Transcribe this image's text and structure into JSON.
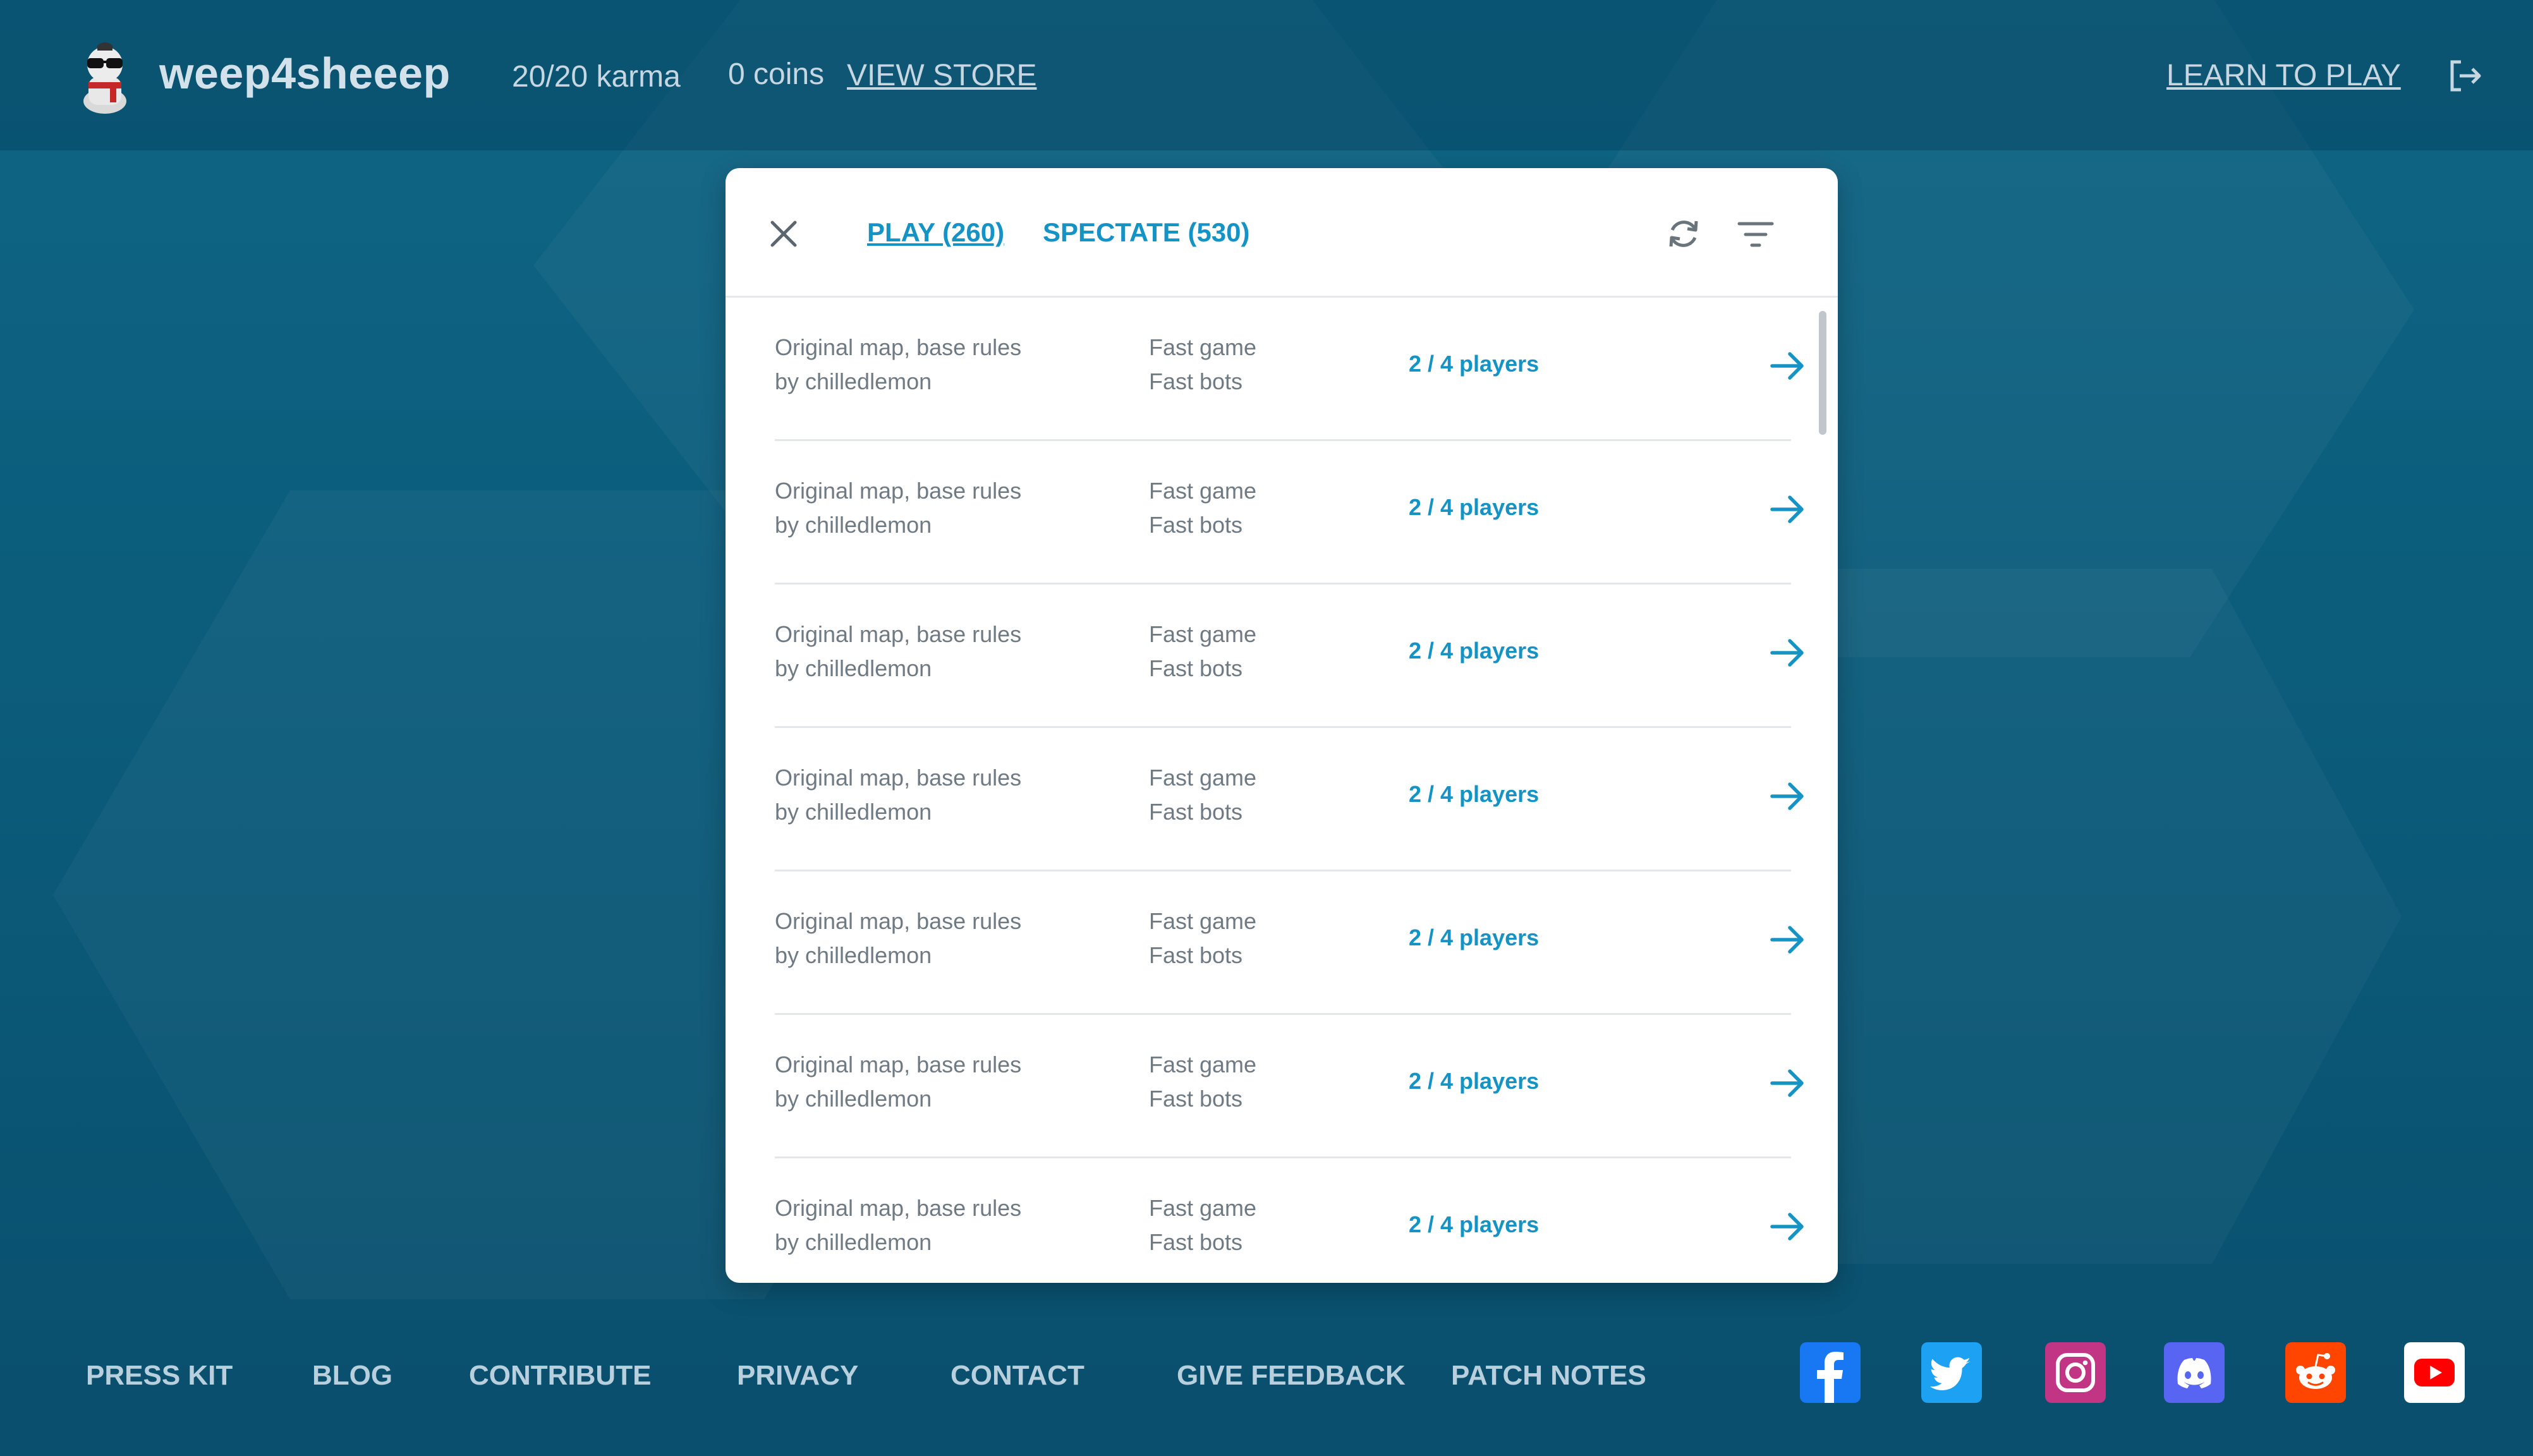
{
  "header": {
    "username": "weep4sheeep",
    "karma": "20/20 karma",
    "coins": "0 coins",
    "view_store": "VIEW STORE",
    "learn_to_play": "LEARN TO PLAY"
  },
  "dialog": {
    "tabs": [
      {
        "label": "PLAY (260)",
        "active": true
      },
      {
        "label": "SPECTATE (530)",
        "active": false
      }
    ],
    "games": [
      {
        "map": "Original map, base rules",
        "author": "by chilledlemon",
        "speed": "Fast game",
        "bots": "Fast bots",
        "players": "2 / 4 players"
      },
      {
        "map": "Original map, base rules",
        "author": "by chilledlemon",
        "speed": "Fast game",
        "bots": "Fast bots",
        "players": "2 / 4 players"
      },
      {
        "map": "Original map, base rules",
        "author": "by chilledlemon",
        "speed": "Fast game",
        "bots": "Fast bots",
        "players": "2 / 4 players"
      },
      {
        "map": "Original map, base rules",
        "author": "by chilledlemon",
        "speed": "Fast game",
        "bots": "Fast bots",
        "players": "2 / 4 players"
      },
      {
        "map": "Original map, base rules",
        "author": "by chilledlemon",
        "speed": "Fast game",
        "bots": "Fast bots",
        "players": "2 / 4 players"
      },
      {
        "map": "Original map, base rules",
        "author": "by chilledlemon",
        "speed": "Fast game",
        "bots": "Fast bots",
        "players": "2 / 4 players"
      },
      {
        "map": "Original map, base rules",
        "author": "by chilledlemon",
        "speed": "Fast game",
        "bots": "Fast bots",
        "players": "2 / 4 players"
      }
    ]
  },
  "footer": {
    "links": [
      "PRESS KIT",
      "BLOG",
      "CONTRIBUTE",
      "PRIVACY",
      "CONTACT",
      "GIVE FEEDBACK",
      "PATCH NOTES"
    ],
    "social": [
      {
        "icon": "facebook-icon",
        "color": "#1877f2"
      },
      {
        "icon": "twitter-icon",
        "color": "#1da1f2"
      },
      {
        "icon": "instagram-icon",
        "color": "#c13584"
      },
      {
        "icon": "discord-icon",
        "color": "#5865f2"
      },
      {
        "icon": "reddit-icon",
        "color": "#ff4500"
      },
      {
        "icon": "youtube-icon",
        "color": "#ff0000"
      }
    ]
  },
  "colors": {
    "background": "#0d5f7f",
    "accent": "#1593c4",
    "muted_text": "#6f7a82"
  }
}
